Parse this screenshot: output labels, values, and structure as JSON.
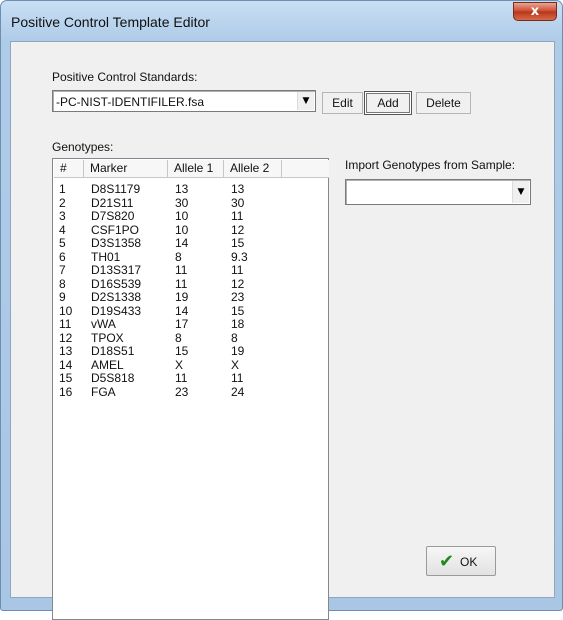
{
  "window": {
    "title": "Positive Control Template Editor",
    "close_glyph": "x"
  },
  "standards": {
    "label": "Positive Control Standards:",
    "selected": "-PC-NIST-IDENTIFILER.fsa",
    "edit_label": "Edit",
    "add_label": "Add",
    "delete_label": "Delete"
  },
  "genotypes": {
    "label": "Genotypes:",
    "columns": [
      "#",
      "Marker",
      "Allele 1",
      "Allele 2"
    ],
    "rows": [
      [
        "1",
        "D8S1179",
        "13",
        "13"
      ],
      [
        "2",
        "D21S11",
        "30",
        "30"
      ],
      [
        "3",
        "D7S820",
        "10",
        "11"
      ],
      [
        "4",
        "CSF1PO",
        "10",
        "12"
      ],
      [
        "5",
        "D3S1358",
        "14",
        "15"
      ],
      [
        "6",
        "TH01",
        "8",
        "9.3"
      ],
      [
        "7",
        "D13S317",
        "11",
        "11"
      ],
      [
        "8",
        "D16S539",
        "11",
        "12"
      ],
      [
        "9",
        "D2S1338",
        "19",
        "23"
      ],
      [
        "10",
        "D19S433",
        "14",
        "15"
      ],
      [
        "11",
        "vWA",
        "17",
        "18"
      ],
      [
        "12",
        "TPOX",
        "8",
        "8"
      ],
      [
        "13",
        "D18S51",
        "15",
        "19"
      ],
      [
        "14",
        "AMEL",
        "X",
        "X"
      ],
      [
        "15",
        "D5S818",
        "11",
        "11"
      ],
      [
        "16",
        "FGA",
        "23",
        "24"
      ]
    ]
  },
  "import": {
    "label": "Import Genotypes from Sample:",
    "selected": ""
  },
  "ok": {
    "label": "OK",
    "icon": "checkmark-icon"
  }
}
